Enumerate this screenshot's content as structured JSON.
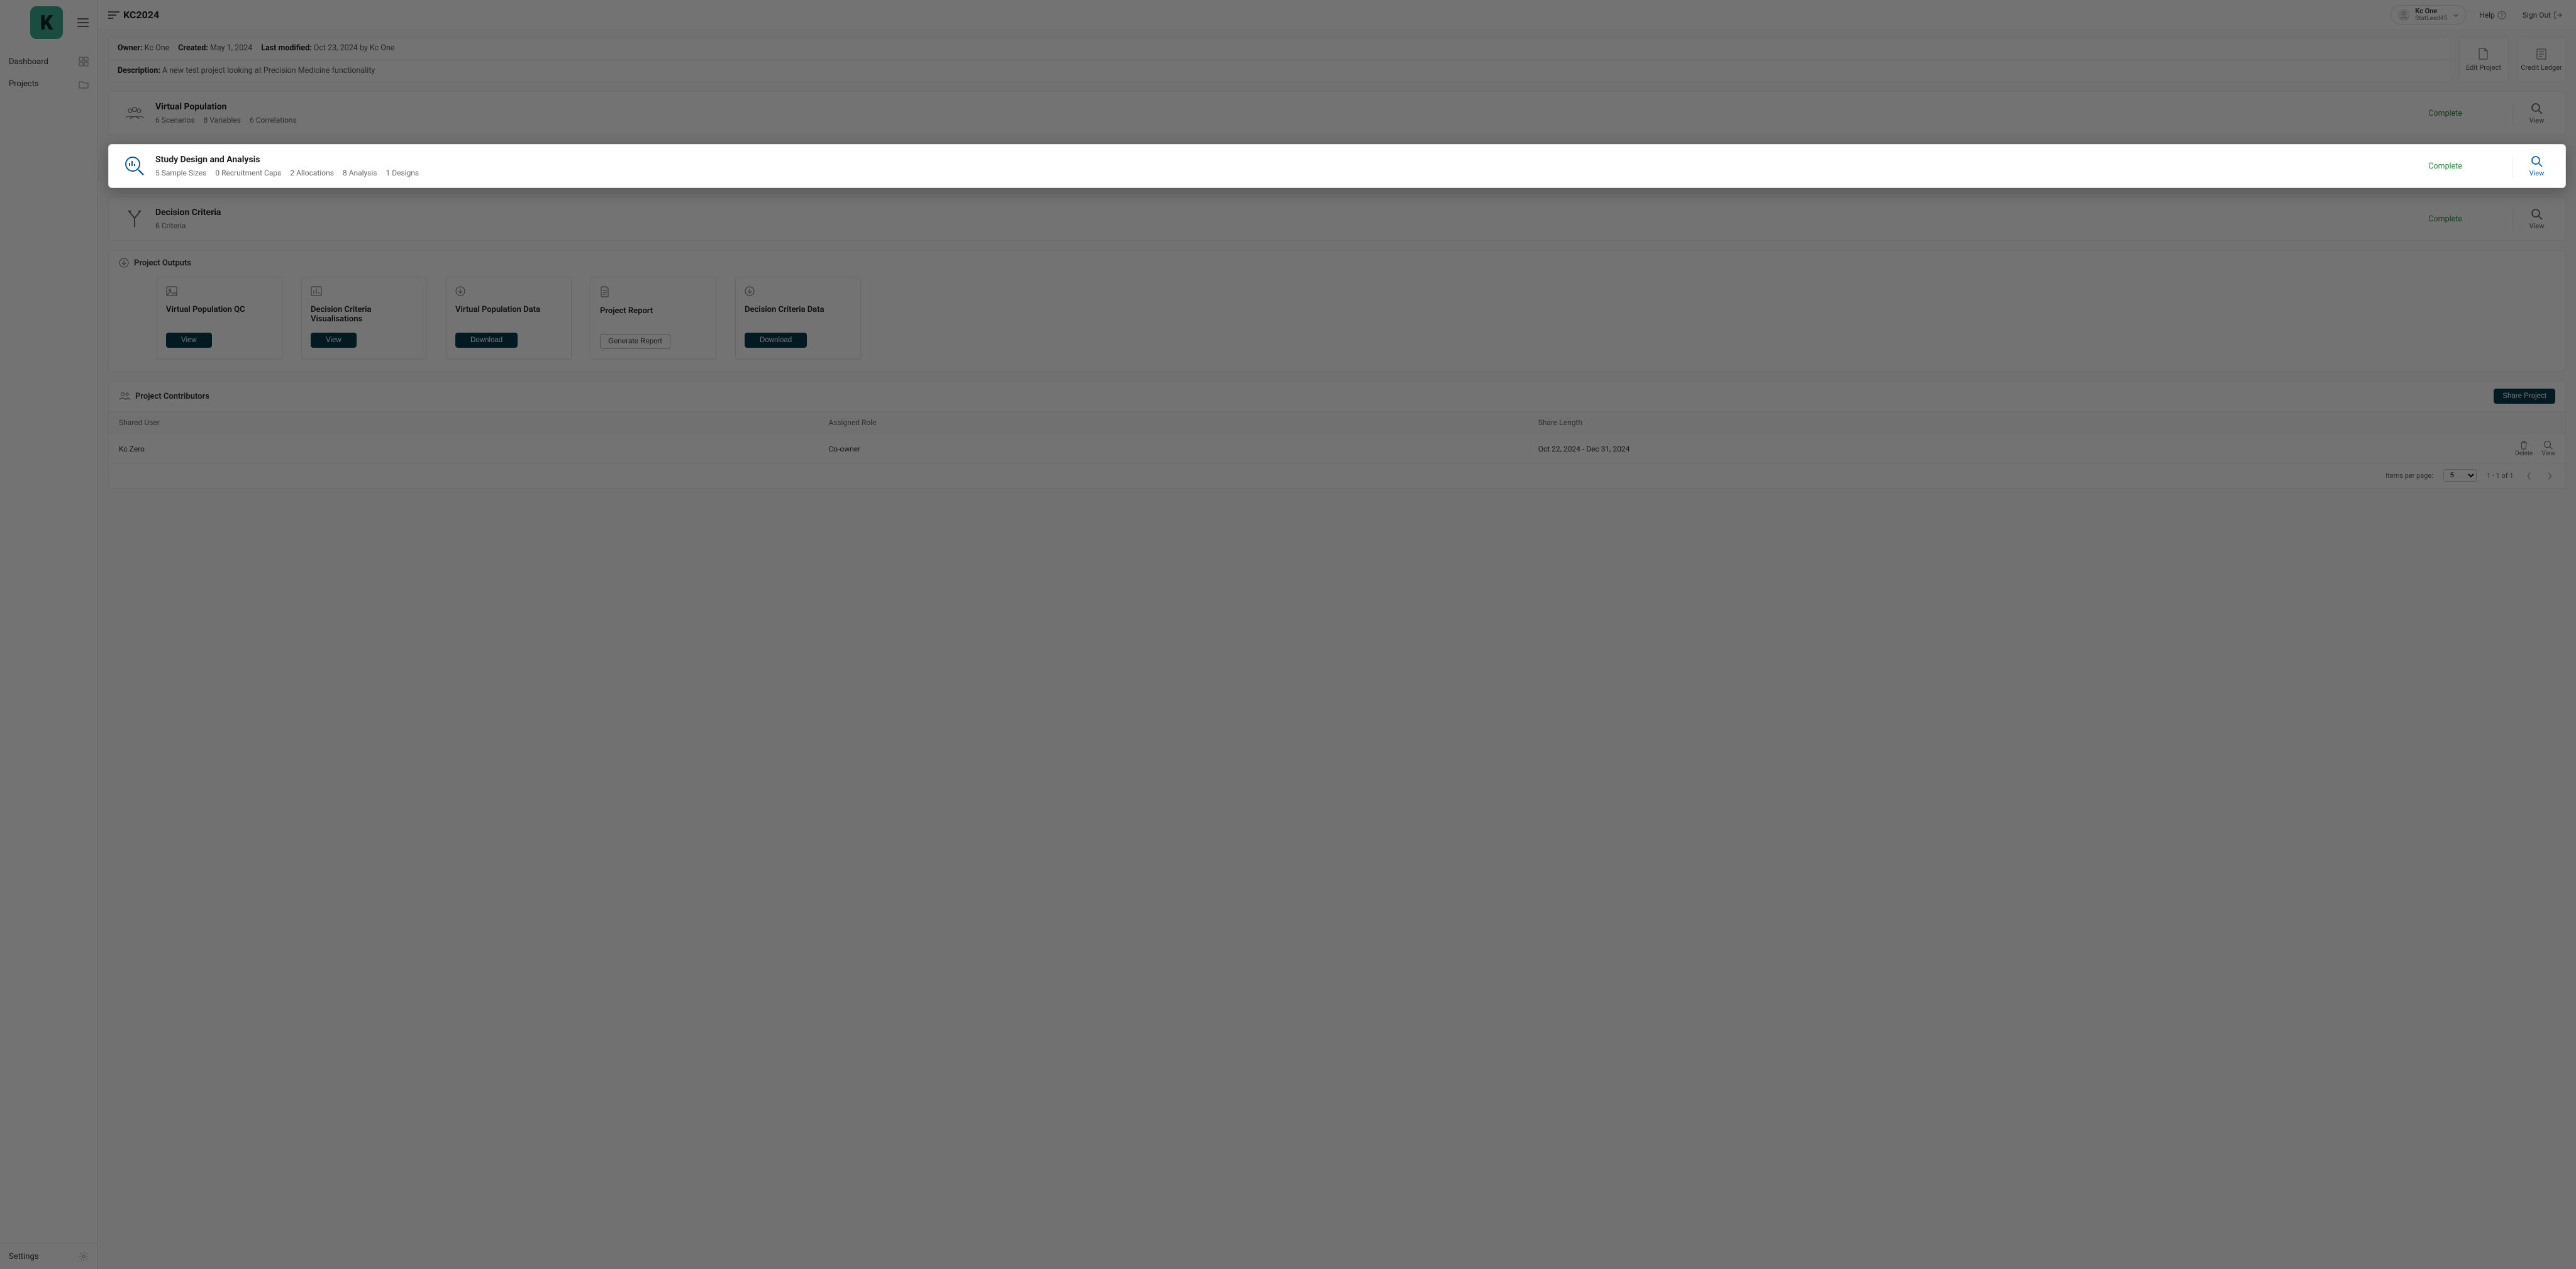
{
  "app": {
    "logo_letter": "K"
  },
  "sidebar": {
    "items": [
      {
        "label": "Dashboard"
      },
      {
        "label": "Projects"
      }
    ],
    "settings_label": "Settings"
  },
  "header": {
    "project_title": "KC2024",
    "help_label": "Help",
    "signout_label": "Sign Out",
    "user": {
      "name": "Kc One",
      "role": "StatLead45"
    }
  },
  "meta": {
    "owner_label": "Owner:",
    "owner_value": "Kc One",
    "created_label": "Created:",
    "created_value": "May 1, 2024",
    "modified_label": "Last modified:",
    "modified_value": "Oct 23, 2024 by Kc One",
    "description_label": "Description:",
    "description_value": "A new test project looking at Precision Medicine functionality"
  },
  "actions": {
    "edit_label": "Edit Project",
    "ledger_label": "Credit Ledger"
  },
  "sections": {
    "view_label": "View",
    "vp": {
      "title": "Virtual Population",
      "subs": [
        "6 Scenarios",
        "8 Variables",
        "6 Correlations"
      ],
      "status": "Complete"
    },
    "sda": {
      "title": "Study Design and Analysis",
      "subs": [
        "5 Sample Sizes",
        "0 Recruitment Caps",
        "2 Allocations",
        "8 Analysis",
        "1 Designs"
      ],
      "status": "Complete"
    },
    "dc": {
      "title": "Decision Criteria",
      "subs": [
        "6 Criteria"
      ],
      "status": "Complete"
    }
  },
  "outputs": {
    "heading": "Project Outputs",
    "cards": [
      {
        "title": "Virtual Population QC",
        "btn": "View",
        "btn_type": "solid"
      },
      {
        "title": "Decision Criteria Visualisations",
        "btn": "View",
        "btn_type": "solid"
      },
      {
        "title": "Virtual Population Data",
        "btn": "Download",
        "btn_type": "solid"
      },
      {
        "title": "Project Report",
        "btn": "Generate Report",
        "btn_type": "outline"
      },
      {
        "title": "Decision Criteria Data",
        "btn": "Download",
        "btn_type": "solid"
      }
    ]
  },
  "contributors": {
    "heading": "Project Contributors",
    "share_label": "Share Project",
    "columns": {
      "user": "Shared User",
      "role": "Assigned Role",
      "length": "Share Length"
    },
    "rows": [
      {
        "user": "Kc Zero",
        "role": "Co-owner",
        "length": "Oct 22, 2024 - Dec 31, 2024"
      }
    ],
    "row_actions": {
      "delete": "Delete",
      "view": "View"
    },
    "pager": {
      "items_label": "Items per page:",
      "page_size": "5",
      "range": "1 - 1 of 1"
    }
  }
}
